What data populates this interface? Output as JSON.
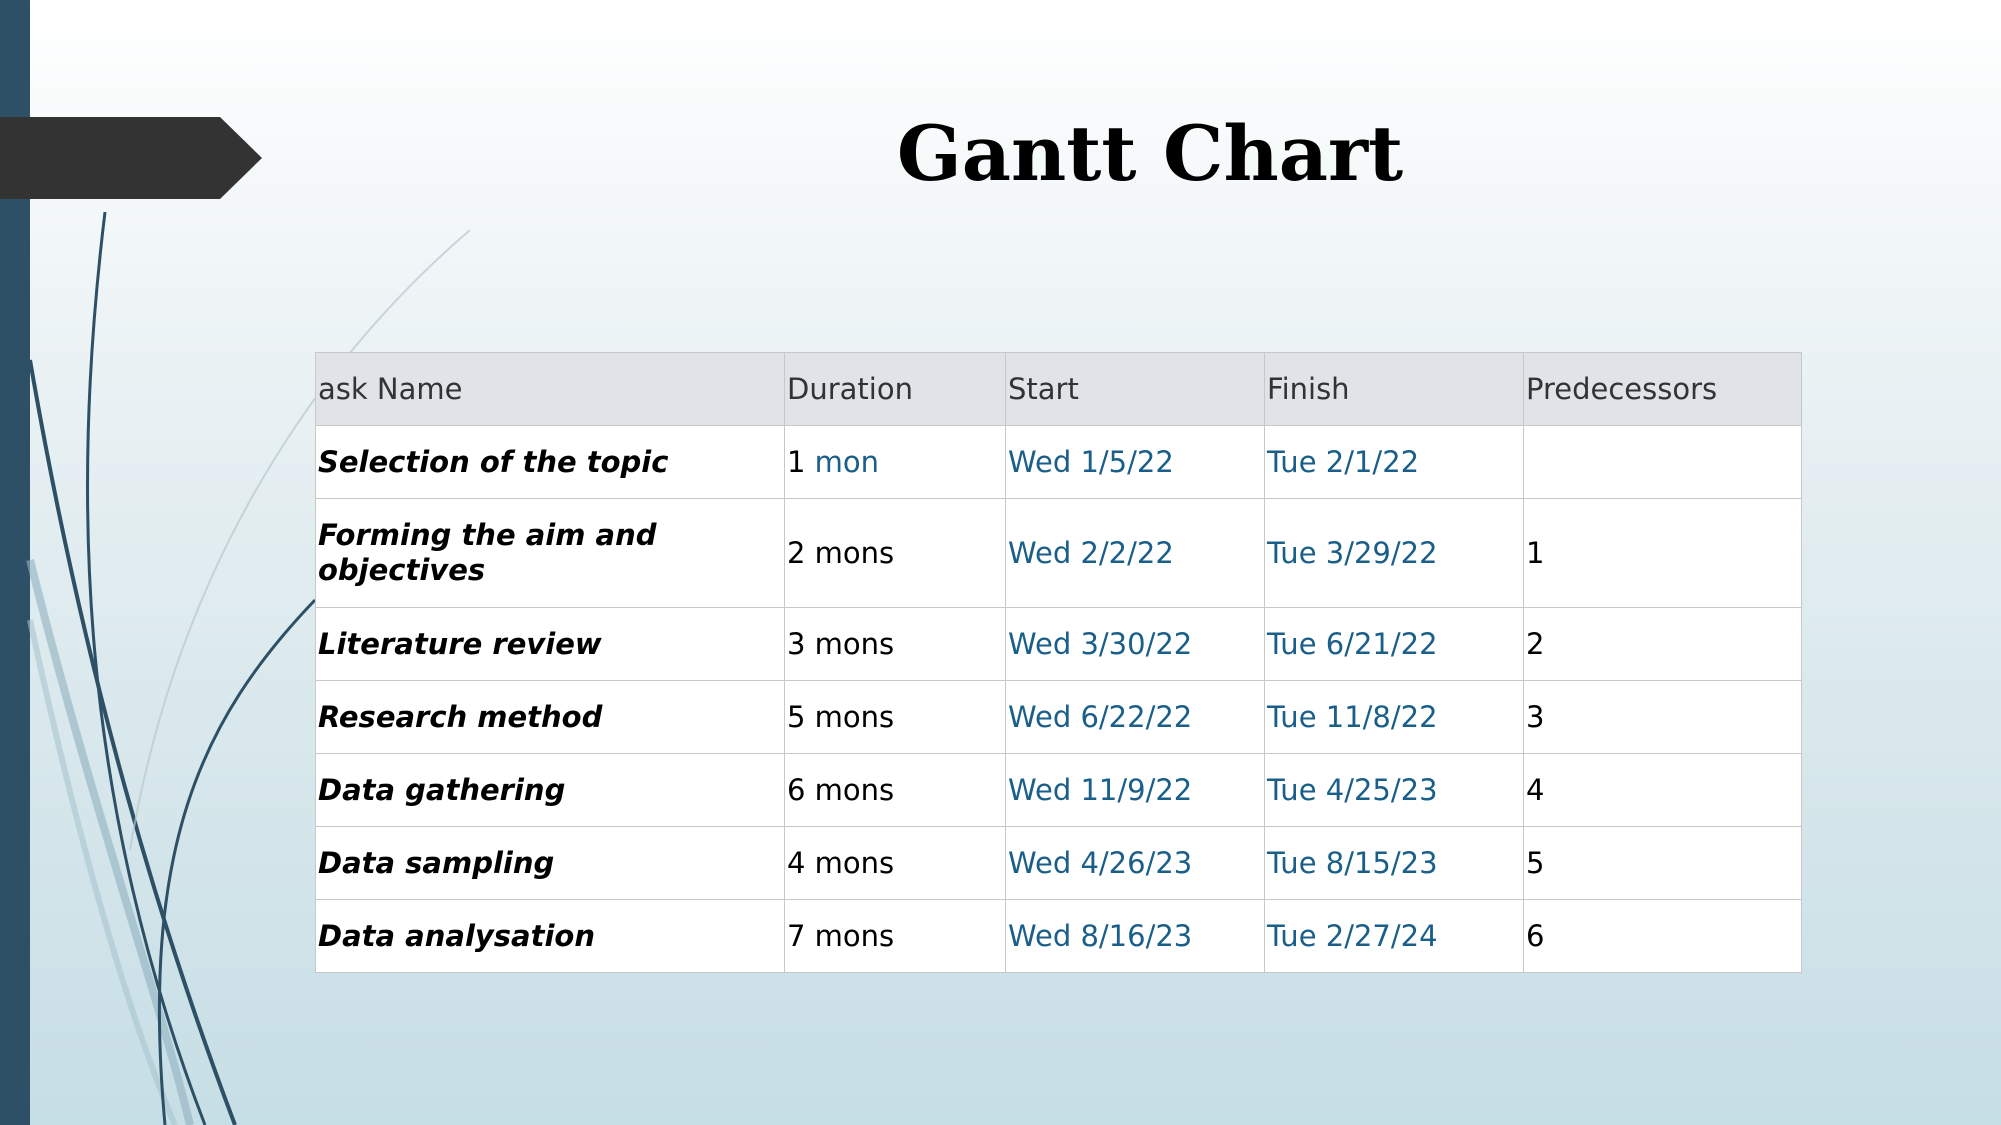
{
  "slide": {
    "title": "Gantt Chart"
  },
  "table": {
    "headers": [
      "ask Name",
      "Duration",
      "Start",
      "Finish",
      "Predecessors"
    ],
    "rows": [
      {
        "task": "Selection of the topic",
        "duration_num": "1",
        "duration_unit": "mon",
        "start": "Wed 1/5/22",
        "finish": "Tue 2/1/22",
        "predecessors": ""
      },
      {
        "task": "Forming the aim and objectives",
        "duration": "2 mons",
        "start": "Wed 2/2/22",
        "finish": "Tue 3/29/22",
        "predecessors": "1"
      },
      {
        "task": "Literature review",
        "duration": "3 mons",
        "start": "Wed 3/30/22",
        "finish": "Tue 6/21/22",
        "predecessors": "2"
      },
      {
        "task": "Research method",
        "duration": "5 mons",
        "start": "Wed 6/22/22",
        "finish": "Tue 11/8/22",
        "predecessors": "3"
      },
      {
        "task": "Data gathering",
        "duration": "6 mons",
        "start": "Wed 11/9/22",
        "finish": "Tue 4/25/23",
        "predecessors": "4"
      },
      {
        "task": "Data sampling",
        "duration": "4 mons",
        "start": "Wed 4/26/23",
        "finish": "Tue 8/15/23",
        "predecessors": "5"
      },
      {
        "task": "Data analysation",
        "duration": "7 mons",
        "start": "Wed 8/16/23",
        "finish": "Tue 2/27/24",
        "predecessors": "6"
      }
    ]
  },
  "colors": {
    "accent_bar": "#2e5066",
    "date_text": "#1a5e8a",
    "header_bg": "#e0e3e7",
    "arrow_tab": "#333333"
  }
}
